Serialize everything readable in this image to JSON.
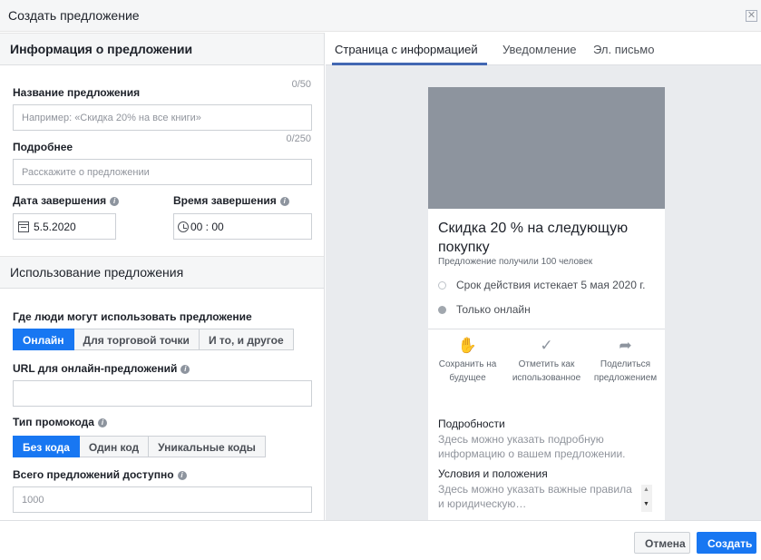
{
  "dialog": {
    "title": "Создать предложение",
    "close_glyph": "✕"
  },
  "left": {
    "section1_title": "Информация о предложении",
    "name": {
      "label": "Название предложения",
      "counter": "0/50",
      "placeholder": "Например: «Скидка 20% на все книги»"
    },
    "details": {
      "label": "Подробнее",
      "counter": "0/250",
      "placeholder": "Расскажите о предложении"
    },
    "end_date": {
      "label": "Дата завершения",
      "value": "5.5.2020"
    },
    "end_time": {
      "label": "Время завершения",
      "value": "00 : 00"
    },
    "section2_title": "Использование предложения",
    "where": {
      "label": "Где люди могут использовать предложение",
      "options": [
        "Онлайн",
        "Для торговой точки",
        "И то, и другое"
      ],
      "selected": "Онлайн"
    },
    "url": {
      "label": "URL для онлайн-предложений",
      "value": ""
    },
    "promo": {
      "label": "Тип промокода",
      "options": [
        "Без кода",
        "Один код",
        "Уникальные коды"
      ],
      "selected": "Без кода"
    },
    "total": {
      "label": "Всего предложений доступно",
      "placeholder": "1000"
    }
  },
  "preview": {
    "tabs": [
      "Страница с информацией",
      "Уведомление",
      "Эл. письмо"
    ],
    "active_tab": "Страница с информацией",
    "card": {
      "title": "Скидка 20 % на следующую покупку",
      "subtitle": "Предложение получили 100 человек",
      "expiry": "Срок действия истекает 5 мая 2020 г.",
      "online": "Только онлайн",
      "actions": [
        {
          "label": "Сохранить на будущее",
          "icon": "hand-save-icon"
        },
        {
          "label": "Отметить как использованное",
          "icon": "checkmark-icon"
        },
        {
          "label": "Поделиться предложением",
          "icon": "share-arrow-icon"
        }
      ],
      "details_heading": "Подробности",
      "details_text": "Здесь можно указать подробную информацию о вашем предложении.",
      "terms_heading": "Условия и положения",
      "terms_text": "Здесь можно указать важные правила и юридическую…"
    }
  },
  "footer": {
    "cancel": "Отмена",
    "create": "Создать"
  },
  "colors": {
    "primary": "#1877f2",
    "tab_underline": "#4267b2",
    "hero_gray": "#8d949e",
    "panel_bg": "#e9ebee"
  }
}
